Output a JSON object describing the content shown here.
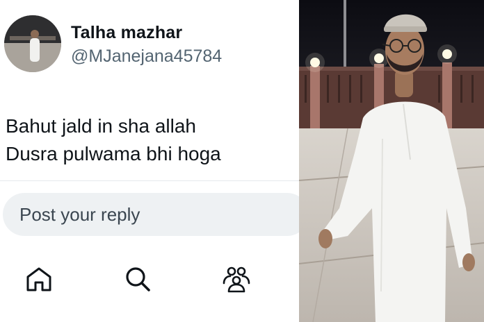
{
  "tweet": {
    "display_name": "Talha mazhar",
    "handle": "@MJanejana45784",
    "text_lines": [
      "Bahut jald in sha allah",
      "Dusra pulwama bhi hoga"
    ]
  },
  "reply": {
    "placeholder": "Post your reply"
  },
  "nav": {
    "items": [
      {
        "icon": "home-icon"
      },
      {
        "icon": "search-icon"
      },
      {
        "icon": "communities-icon"
      }
    ]
  },
  "photo": {
    "subject": "person-in-white-kurta-photo"
  },
  "colors": {
    "text_primary": "#0f1419",
    "text_secondary": "#536471",
    "reply_bg": "#eef1f3",
    "divider": "#e6e9ec"
  }
}
